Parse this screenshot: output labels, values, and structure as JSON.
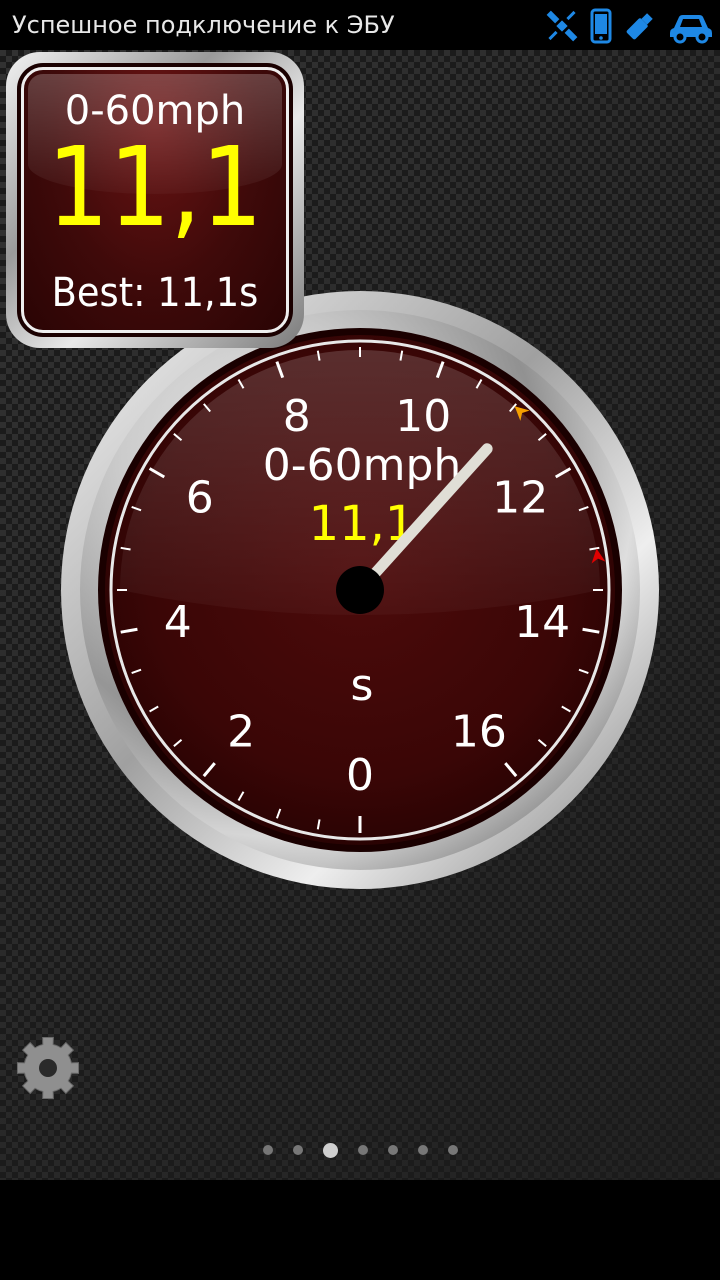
{
  "status_bar": {
    "text": "Успешное подключение к ЭБУ",
    "icons": [
      "satellite-icon",
      "phone-icon",
      "usb-dongle-icon",
      "car-icon"
    ],
    "icon_color": "#1e88e5"
  },
  "widget": {
    "title": "0-60mph",
    "value": "11,1",
    "best": "Best: 11,1s",
    "value_color": "#ffff00"
  },
  "gauge": {
    "title": "0-60mph",
    "value": "11,1",
    "unit": "s",
    "scale_labels": [
      "0",
      "2",
      "4",
      "6",
      "8",
      "10",
      "12",
      "14",
      "16"
    ],
    "scale_min": 0,
    "scale_max": 16,
    "needle_value": 11.1,
    "best_marker_value": 11.1,
    "best_marker_color": "#f5a000",
    "red_marker_value": 13.1,
    "red_marker_color": "#e00000",
    "value_color": "#ffff00"
  },
  "pager": {
    "count": 7,
    "active_index": 2
  },
  "settings": {
    "icon": "gear-icon"
  }
}
